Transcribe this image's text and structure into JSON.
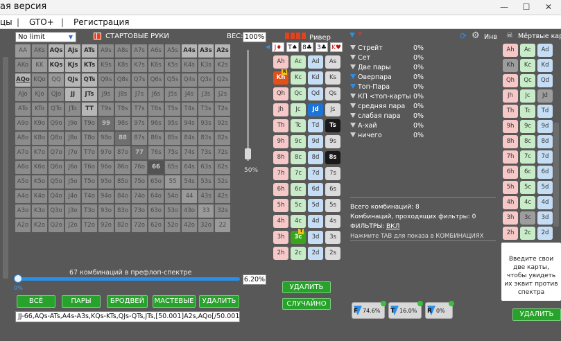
{
  "window": {
    "title": "ая версия"
  },
  "menu": {
    "items": [
      "цы",
      "|",
      "GTO+",
      "|",
      "Регистрация"
    ]
  },
  "preflop": {
    "limit_select": "No limit",
    "starting_hands_label": "СТАРТОВЫЕ РУКИ",
    "weight_label": "ВЕС:",
    "weight_value": "100%",
    "slider_pct": "50%",
    "range_text": "67 комбинаций в префлоп-спектре",
    "range_pct": "6.20%",
    "progress_left": "0%",
    "buttons": {
      "all": "ВСЁ",
      "pairs": "ПАРЫ",
      "broadway": "БРОДВЕЙ",
      "suited": "МАСТЕВЫЕ",
      "delete": "УДАЛИТЬ"
    },
    "range_string": "JJ-66,AQs-ATs,A4s-A3s,KQs-KTs,QJs-QTs,JTs,[50.001]A2s,AQo[/50.001]",
    "matrix": [
      [
        "AA",
        "AKs",
        "AQs",
        "AJs",
        "ATs",
        "A9s",
        "A8s",
        "A7s",
        "A6s",
        "A5s",
        "A4s",
        "A3s",
        "A2s"
      ],
      [
        "AKo",
        "KK",
        "KQs",
        "KJs",
        "KTs",
        "K9s",
        "K8s",
        "K7s",
        "K6s",
        "K5s",
        "K4s",
        "K3s",
        "K2s"
      ],
      [
        "AQo",
        "KQo",
        "QQ",
        "QJs",
        "QTs",
        "Q9s",
        "Q8s",
        "Q7s",
        "Q6s",
        "Q5s",
        "Q4s",
        "Q3s",
        "Q2s"
      ],
      [
        "AJo",
        "KJo",
        "QJo",
        "JJ",
        "JTs",
        "J9s",
        "J8s",
        "J7s",
        "J6s",
        "J5s",
        "J4s",
        "J3s",
        "J2s"
      ],
      [
        "ATo",
        "KTo",
        "QTo",
        "JTo",
        "TT",
        "T9s",
        "T8s",
        "T7s",
        "T6s",
        "T5s",
        "T4s",
        "T3s",
        "T2s"
      ],
      [
        "A9o",
        "K9o",
        "Q9o",
        "J9o",
        "T9o",
        "99",
        "98s",
        "97s",
        "96s",
        "95s",
        "94s",
        "93s",
        "92s"
      ],
      [
        "A8o",
        "K8o",
        "Q8o",
        "J8o",
        "T8o",
        "98o",
        "88",
        "87s",
        "86s",
        "85s",
        "84s",
        "83s",
        "82s"
      ],
      [
        "A7o",
        "K7o",
        "Q7o",
        "J7o",
        "T7o",
        "97o",
        "87o",
        "77",
        "76s",
        "75s",
        "74s",
        "73s",
        "72s"
      ],
      [
        "A6o",
        "K6o",
        "Q6o",
        "J6o",
        "T6o",
        "96o",
        "86o",
        "76o",
        "66",
        "65s",
        "64s",
        "63s",
        "62s"
      ],
      [
        "A5o",
        "K5o",
        "Q5o",
        "J5o",
        "T5o",
        "95o",
        "85o",
        "75o",
        "65o",
        "55",
        "54s",
        "53s",
        "52s"
      ],
      [
        "A4o",
        "K4o",
        "Q4o",
        "J4o",
        "T4o",
        "94o",
        "84o",
        "74o",
        "64o",
        "54o",
        "44",
        "43s",
        "42s"
      ],
      [
        "A3o",
        "K3o",
        "Q3o",
        "J3o",
        "T3o",
        "93o",
        "83o",
        "73o",
        "63o",
        "53o",
        "43o",
        "33",
        "32s"
      ],
      [
        "A2o",
        "K2o",
        "Q2o",
        "J2o",
        "T2o",
        "92o",
        "82o",
        "72o",
        "62o",
        "52o",
        "42o",
        "32o",
        "22"
      ]
    ]
  },
  "board": {
    "label": "Ривер",
    "cards": [
      "J♦",
      "T♠",
      "8♣",
      "3♣",
      "K♥"
    ],
    "ranks": [
      "A",
      "K",
      "Q",
      "J",
      "T",
      "9",
      "8",
      "7",
      "6",
      "5",
      "4",
      "3",
      "2"
    ],
    "suits": [
      "h",
      "c",
      "d",
      "s"
    ],
    "delete_label": "УДАЛИТЬ",
    "random_label": "СЛУЧАЙНО"
  },
  "stats": {
    "items": [
      {
        "label": "Стрейт",
        "value": "0%",
        "blue": false
      },
      {
        "label": "Сет",
        "value": "0%",
        "blue": false
      },
      {
        "label": "Две пары",
        "value": "0%",
        "blue": false
      },
      {
        "label": "Оверпара",
        "value": "0%",
        "blue": true
      },
      {
        "label": "Топ-Пара",
        "value": "0%",
        "blue": true
      },
      {
        "label": "КП <топ-карты",
        "value": "0%",
        "blue": false
      },
      {
        "label": "средняя пара",
        "value": "0%",
        "blue": false
      },
      {
        "label": "слабая пара",
        "value": "0%",
        "blue": false
      },
      {
        "label": "А-хай",
        "value": "0%",
        "blue": false
      },
      {
        "label": "ничего",
        "value": "0%",
        "blue": false
      }
    ],
    "inv_label": "Инв",
    "total_combos": "Всего комбинаций: 8",
    "filter_combos": "Комбинаций, проходящих фильтры: 0",
    "filters_label": "ФИЛЬТРЫ:",
    "filters_value": "ВКЛ",
    "tab_hint": "Нажмите TAB для показа в КОМБИНАЦИЯХ",
    "funnels": [
      {
        "letter": "F",
        "value": "74.6%"
      },
      {
        "letter": "T",
        "value": "16.0%"
      },
      {
        "letter": "R",
        "value": "0%"
      }
    ]
  },
  "dead": {
    "label": "Мёртвые карт",
    "rows": [
      [
        "Ah",
        "Ac",
        "Ad"
      ],
      [
        "Kh",
        "Kc",
        "Kd"
      ],
      [
        "Qh",
        "Qc",
        "Qd"
      ],
      [
        "Jh",
        "Jc",
        "Jd"
      ],
      [
        "Th",
        "Tc",
        "Td"
      ],
      [
        "9h",
        "9c",
        "9d"
      ],
      [
        "8h",
        "8c",
        "8d"
      ],
      [
        "7h",
        "7c",
        "7d"
      ],
      [
        "6h",
        "6c",
        "6d"
      ],
      [
        "5h",
        "5c",
        "5d"
      ],
      [
        "4h",
        "4c",
        "4d"
      ],
      [
        "3h",
        "3c",
        "3d"
      ],
      [
        "2h",
        "2c",
        "2d"
      ]
    ],
    "hint": "Введите свои две карты, чтобы увидеть их эквит против спектра",
    "delete_label": "УДАЛИТЬ"
  }
}
